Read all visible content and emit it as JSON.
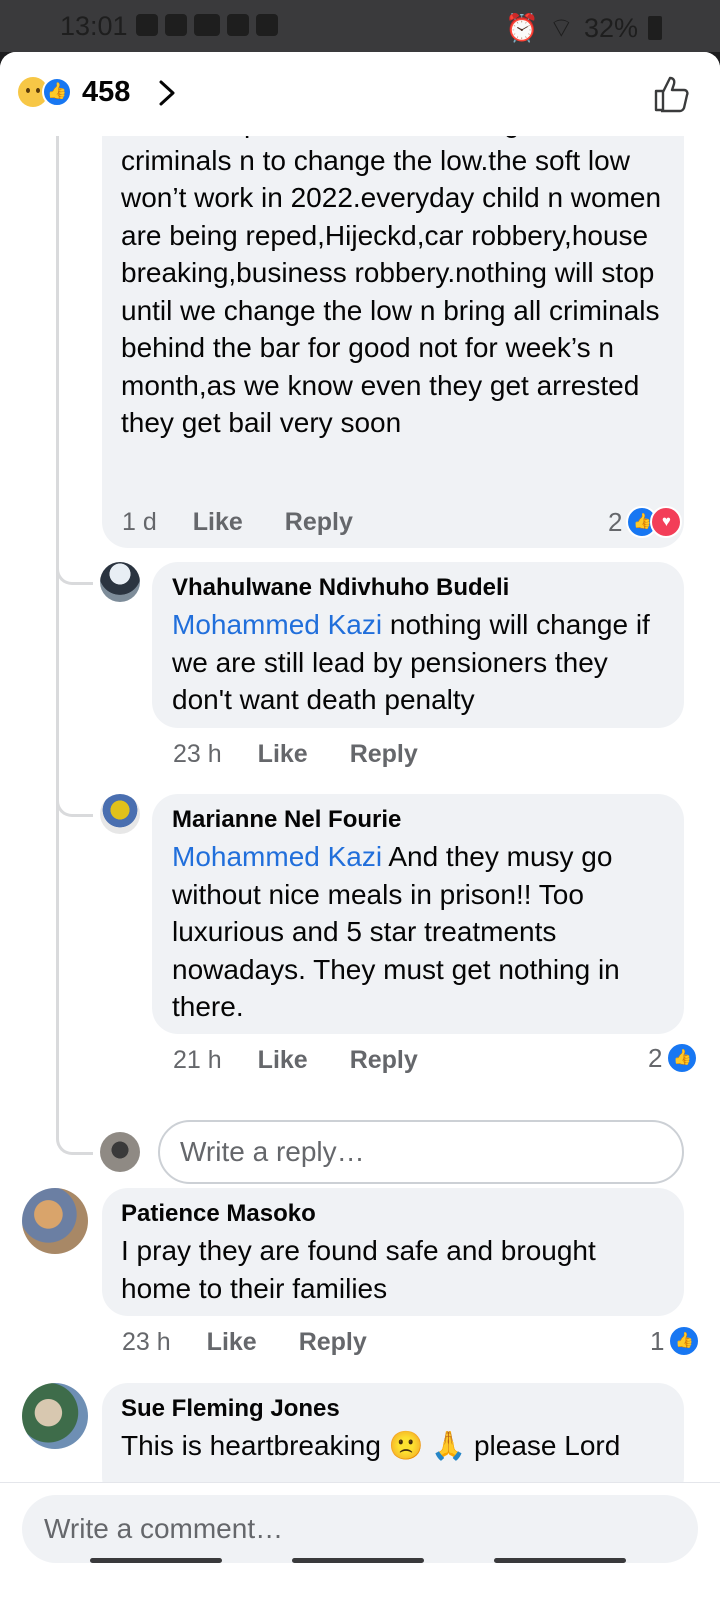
{
  "status_bar": {
    "time": "13:01",
    "battery": "32%"
  },
  "header": {
    "reaction_count": "458"
  },
  "comments": {
    "c1": {
      "text": "to come up for national strike against Crim n criminals n to change the low.the soft low won’t work in 2022.everyday child n women are being reped,Hijeckd,car robbery,house breaking,business robbery.nothing will stop until we change the low n bring all criminals behind the bar for good not for week’s n month,as we know even they get arrested they get bail very soon",
      "time": "1 d",
      "like": "Like",
      "reply": "Reply",
      "reactions": "2"
    },
    "r1": {
      "name": "Vhahulwane Ndivhuho Budeli",
      "mention": "Mohammed Kazi",
      "text": " nothing will change if we are still lead by pensioners they don't want death penalty",
      "time": "23 h",
      "like": "Like",
      "reply": "Reply"
    },
    "r2": {
      "name": "Marianne Nel Fourie",
      "mention": "Mohammed Kazi",
      "text": " And they musy go without nice meals in prison!! Too luxurious and 5 star treatments nowadays. They must get nothing in there.",
      "time": "21 h",
      "like": "Like",
      "reply": "Reply",
      "reactions": "2"
    },
    "reply_placeholder": "Write a reply…",
    "c2": {
      "name": "Patience Masoko",
      "text": "I pray they are found safe and brought home to their families",
      "time": "23 h",
      "like": "Like",
      "reply": "Reply",
      "reactions": "1"
    },
    "c3": {
      "name": "Sue Fleming Jones",
      "text": "This is heartbreaking 🙁 🙏 please Lord"
    }
  },
  "composer": {
    "placeholder": "Write a comment…"
  },
  "colors": {
    "accent": "#1877f2",
    "mention": "#216fdb",
    "bubble": "#f0f2f5",
    "love": "#f33e58"
  },
  "icons": [
    "sad-reaction-icon",
    "like-reaction-icon",
    "chevron-right-icon",
    "thumbs-up-icon",
    "love-reaction-icon"
  ]
}
